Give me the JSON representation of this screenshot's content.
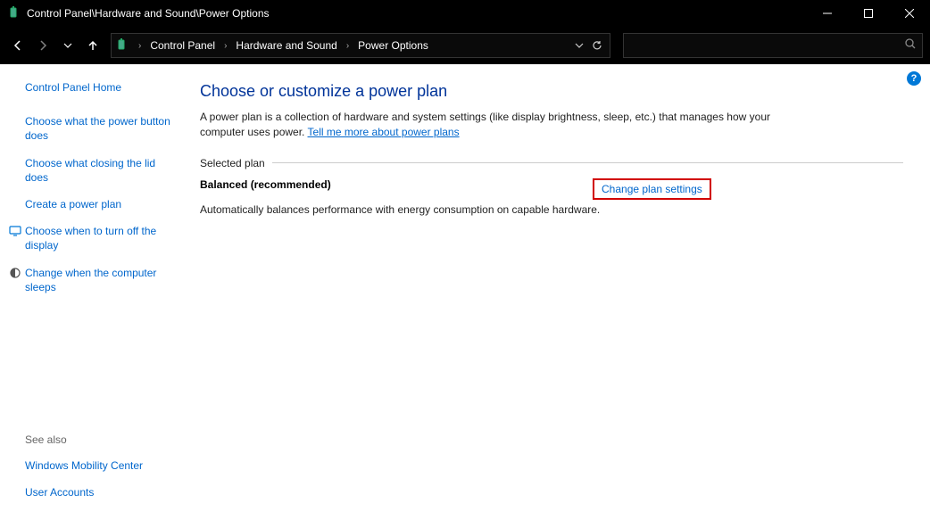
{
  "titlebar": {
    "title": "Control Panel\\Hardware and Sound\\Power Options"
  },
  "breadcrumb": {
    "items": [
      "Control Panel",
      "Hardware and Sound",
      "Power Options"
    ]
  },
  "search": {
    "placeholder": ""
  },
  "help": {
    "symbol": "?"
  },
  "sidebar": {
    "home": "Control Panel Home",
    "links": [
      "Choose what the power button does",
      "Choose what closing the lid does",
      "Create a power plan",
      "Choose when to turn off the display",
      "Change when the computer sleeps"
    ],
    "see_also_heading": "See also",
    "see_also": [
      "Windows Mobility Center",
      "User Accounts"
    ]
  },
  "main": {
    "title": "Choose or customize a power plan",
    "desc_prefix": "A power plan is a collection of hardware and system settings (like display brightness, sleep, etc.) that manages how your computer uses power. ",
    "desc_link": "Tell me more about power plans",
    "section_label": "Selected plan",
    "plan": {
      "name": "Balanced (recommended)",
      "change_label": "Change plan settings",
      "sub": "Automatically balances performance with energy consumption on capable hardware."
    }
  }
}
